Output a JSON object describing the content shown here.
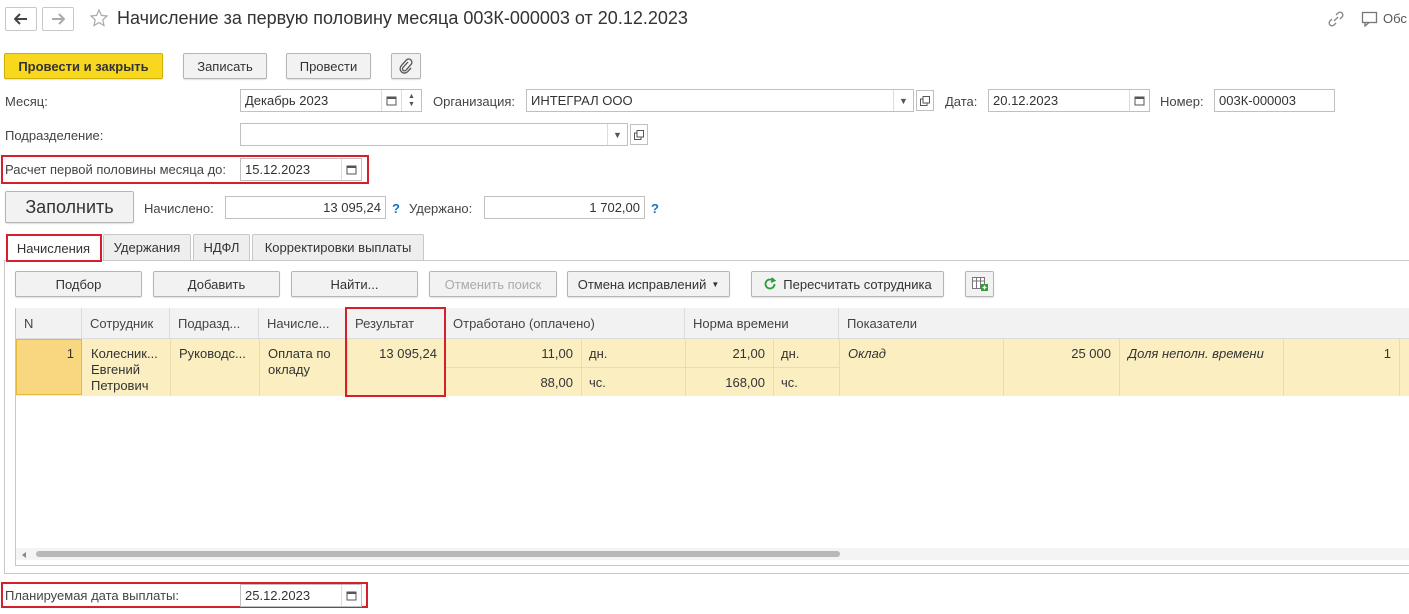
{
  "window": {
    "title": "Начисление за первую половину месяца 003К-000003 от 20.12.2023",
    "more_label": "Обс"
  },
  "toolbar": {
    "post_close_label": "Провести и закрыть",
    "save_label": "Записать",
    "post_label": "Провести"
  },
  "form": {
    "month_label": "Месяц:",
    "month_value": "Декабрь 2023",
    "org_label": "Организация:",
    "org_value": "ИНТЕГРАЛ ООО",
    "date_label": "Дата:",
    "date_value": "20.12.2023",
    "number_label": "Номер:",
    "number_value": "003К-000003",
    "dept_label": "Подразделение:",
    "dept_value": "",
    "calc_until_label": "Расчет первой половины месяца до:",
    "calc_until_value": "15.12.2023",
    "fill_label": "Заполнить",
    "accrued_label": "Начислено:",
    "accrued_value": "13 095,24",
    "withheld_label": "Удержано:",
    "withheld_value": "1 702,00",
    "help": "?",
    "pay_date_label": "Планируемая дата выплаты:",
    "pay_date_value": "25.12.2023"
  },
  "tabs": [
    "Начисления",
    "Удержания",
    "НДФЛ",
    "Корректировки выплаты"
  ],
  "grid_toolbar": {
    "select_label": "Подбор",
    "add_label": "Добавить",
    "find_label": "Найти...",
    "cancel_search_label": "Отменить поиск",
    "cancel_fix_label": "Отмена исправлений",
    "recalc_label": "Пересчитать сотрудника"
  },
  "grid": {
    "columns": [
      "N",
      "Сотрудник",
      "Подразд...",
      "Начисле...",
      "Результат",
      "Отработано (оплачено)",
      "Норма времени",
      "Показатели"
    ],
    "row": {
      "n": "1",
      "employee_l1": "Колесник...",
      "employee_l2": "Евгений",
      "employee_l3": "Петрович",
      "dept": "Руководс...",
      "accrual_l1": "Оплата по",
      "accrual_l2": "окладу",
      "result": "13 095,24",
      "worked_days": "11,00",
      "worked_days_unit": "дн.",
      "worked_hours": "88,00",
      "worked_hours_unit": "чс.",
      "norm_days": "21,00",
      "norm_days_unit": "дн.",
      "norm_hours": "168,00",
      "norm_hours_unit": "чс.",
      "ind1_name": "Оклад",
      "ind1_value": "25 000",
      "ind2_name": "Доля неполн. времени",
      "ind2_value": "1"
    }
  },
  "colors": {
    "primary_button": "#f8d81e",
    "row_highlight": "#fbefc2",
    "callout_border": "#d3202b",
    "help_blue": "#1a73c0",
    "recalc_green": "#2e9e3a"
  }
}
